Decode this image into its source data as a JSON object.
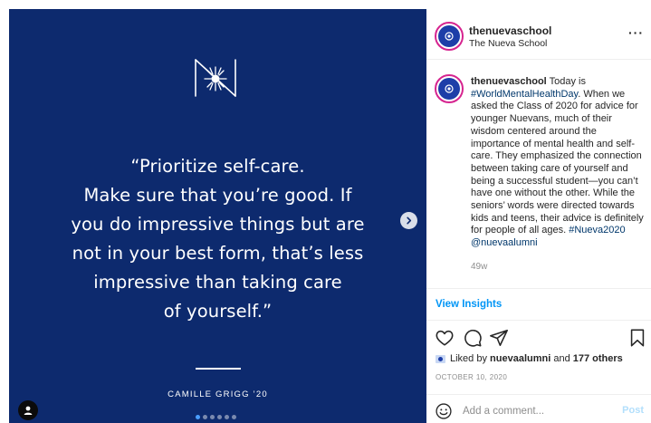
{
  "media": {
    "quote_lines": [
      "“Prioritize self-care.",
      "Make sure that you’re good. If",
      "you do impressive things but are",
      "not in your best form, that’s less",
      "impressive than taking care",
      "of yourself.”"
    ],
    "author": "CAMILLE GRIGG ’20",
    "background_color": "#0d2a6e",
    "carousel_total": 6,
    "carousel_active": 1
  },
  "header": {
    "username": "thenuevaschool",
    "subtitle": "The Nueva School",
    "more_label": "···"
  },
  "caption": {
    "username": "thenuevaschool",
    "text_before": " Today is ",
    "hashtag_1": "#WorldMentalHealthDay",
    "text_body": ". When we asked the Class of 2020 for advice for younger Nuevans, much of their wisdom centered around the importance of mental health and self-care. They emphasized the connection between taking care of yourself and being a successful student—you can’t have one without the other. While the seniors’ words were directed towards kids and teens, their advice is definitely for people of all ages. ",
    "hashtag_2": "#Nueva2020",
    "mention": "@nuevaalumni",
    "time_ago": "49w"
  },
  "insights": {
    "label": "View Insights"
  },
  "likes": {
    "prefix": "Liked by ",
    "user": "nuevaalumni",
    "middle": " and ",
    "others": "177 others"
  },
  "date": "OCTOBER 10, 2020",
  "comment": {
    "placeholder": "Add a comment...",
    "post_label": "Post"
  },
  "colors": {
    "accent_blue": "#0095f6",
    "post_disabled": "#b2dffc",
    "story_ring": "#d6248f"
  }
}
